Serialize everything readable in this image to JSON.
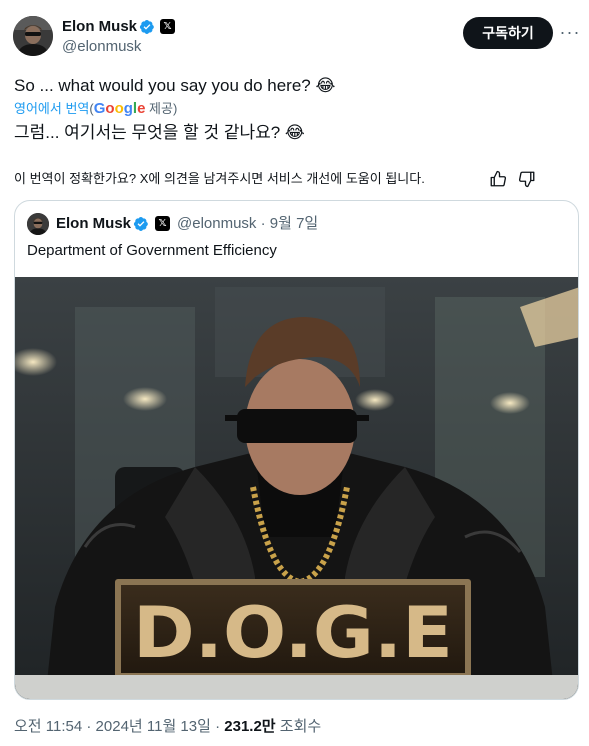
{
  "author": {
    "display_name": "Elon Musk",
    "handle": "@elonmusk",
    "verified_icon": "verified-badge-icon",
    "affiliation_icon": "x-logo-icon",
    "affiliation_glyph": "𝕏"
  },
  "header": {
    "subscribe_label": "구독하기",
    "more_glyph": "···"
  },
  "tweet": {
    "text": "So ... what would you say you do here? 😂",
    "translate_label": "영어에서 번역",
    "translate_open": "(",
    "translate_provider": "Google",
    "translate_suffix": " 제공)",
    "translated_text": "그럼... 여기서는 무엇을 할 것 같나요? 😂",
    "feedback_prompt": "이 번역이 정확한가요? X에 의견을 남겨주시면 서비스 개선에 도움이 됩니다."
  },
  "quote": {
    "display_name": "Elon Musk",
    "handle": "@elonmusk",
    "separator": "·",
    "date": "9월 7일",
    "text": "Department of Government Efficiency",
    "image": {
      "sign_text": "D.O.G.E"
    }
  },
  "footer": {
    "time": "오전 11:54",
    "sep1": "·",
    "date": "2024년 11월 13일",
    "sep2": "·",
    "views_count": "231.2만",
    "views_label": "조회수"
  },
  "colors": {
    "text": "#0f1419",
    "secondary": "#536471",
    "link": "#1d9bf0",
    "border": "#cfd9de",
    "button": "#0f1419",
    "sign_gold": "#d6b988"
  }
}
